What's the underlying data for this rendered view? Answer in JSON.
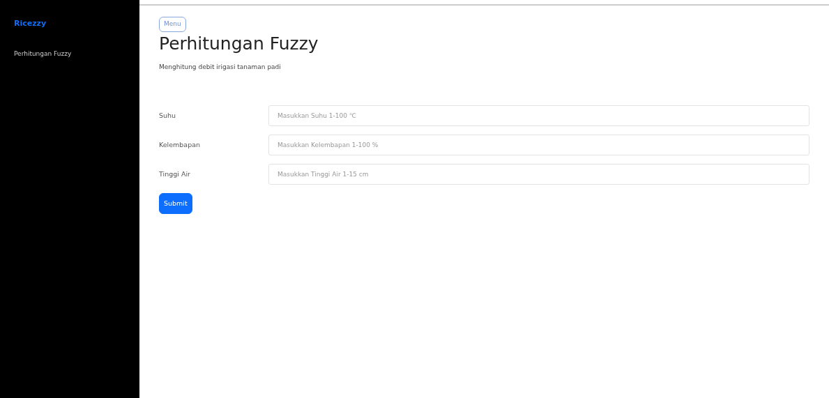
{
  "sidebar": {
    "brand": "Ricezzy",
    "items": [
      {
        "label": "Perhitungan Fuzzy",
        "selected": false
      }
    ]
  },
  "menu_button": "Menu",
  "title": "Perhitungan Fuzzy",
  "subtitle": "Menghitung debit irigasi tanaman padi",
  "fields": [
    {
      "label": "Suhu",
      "placeholder": "Masukkan Suhu 1-100 ℃"
    },
    {
      "label": "Kelembapan",
      "placeholder": "Masukkan Kelembapan 1-100 %"
    },
    {
      "label": "Tinggi Air",
      "placeholder": "Masukkan Tinggi Air 1-15 cm"
    }
  ],
  "submit": "Submit"
}
